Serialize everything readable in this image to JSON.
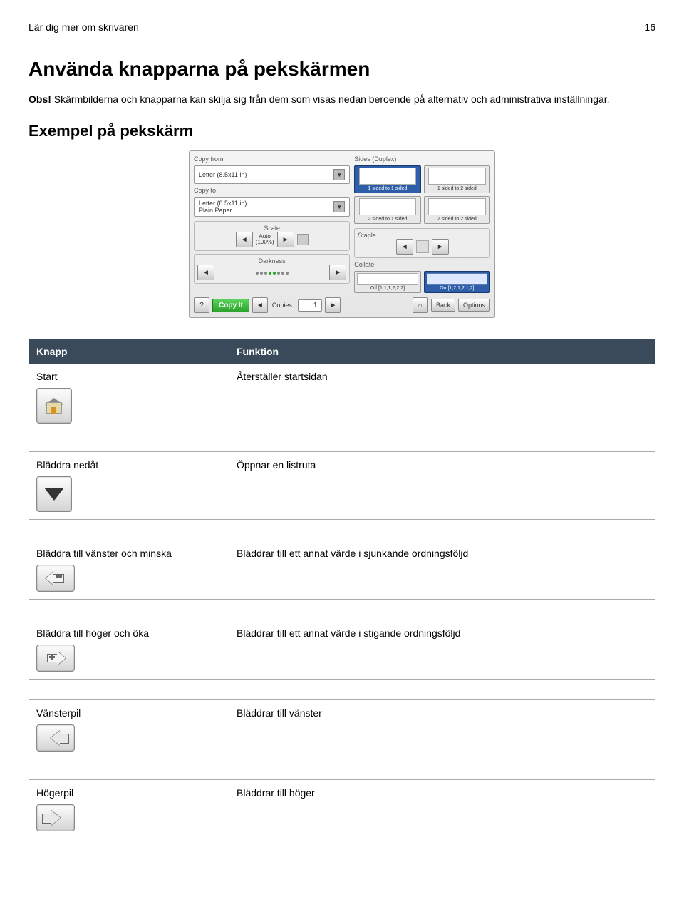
{
  "header": {
    "left": "Lär dig mer om skrivaren",
    "right": "16"
  },
  "h1": "Använda knapparna på pekskärmen",
  "intro_label": "Obs!",
  "intro_text": " Skärmbilderna och knapparna kan skilja sig från dem som visas nedan beroende på alternativ och administrativa inställningar.",
  "h2": "Exempel på pekskärm",
  "shot": {
    "copy_from_lbl": "Copy from",
    "copy_from_val": "Letter (8.5x11 in)",
    "copy_to_lbl": "Copy to",
    "copy_to_val1": "Letter (8.5x11 in)",
    "copy_to_val2": "Plain Paper",
    "scale_lbl": "Scale",
    "scale_val1": "Auto",
    "scale_val2": "(100%)",
    "darkness_lbl": "Darkness",
    "sides_lbl": "Sides (Duplex)",
    "side1": "1 sided to 1 sided",
    "side2": "1 sided to 2 sided",
    "side3": "2 sided to 1 sided",
    "side4": "2 sided to 2 sided",
    "staple_lbl": "Staple",
    "collate_lbl": "Collate",
    "collate_off": "Off [1,1,1,2,2,2]",
    "collate_on": "On [1,2,1,2,1,2]",
    "help": "?",
    "copyit": "Copy It",
    "copies_lbl": "Copies:",
    "copies_val": "1",
    "back": "Back",
    "options": "Options"
  },
  "tables": [
    {
      "h1": "Knapp",
      "h2": "Funktion",
      "rows": [
        {
          "left": "Start",
          "right": "Återställer startsidan",
          "icon": "home"
        }
      ]
    },
    {
      "rows": [
        {
          "left": "Bläddra nedåt",
          "right": "Öppnar en listruta",
          "icon": "down"
        }
      ]
    },
    {
      "rows": [
        {
          "left": "Bläddra till vänster och minska",
          "right": "Bläddrar till ett annat värde i sjunkande ordningsföljd",
          "icon": "left-minus"
        }
      ]
    },
    {
      "rows": [
        {
          "left": "Bläddra till höger och öka",
          "right": "Bläddrar till ett annat värde i stigande ordningsföljd",
          "icon": "right-plus"
        }
      ]
    },
    {
      "rows": [
        {
          "left": "Vänsterpil",
          "right": "Bläddrar till vänster",
          "icon": "left"
        }
      ]
    },
    {
      "rows": [
        {
          "left": "Högerpil",
          "right": "Bläddrar till höger",
          "icon": "right"
        }
      ]
    }
  ]
}
